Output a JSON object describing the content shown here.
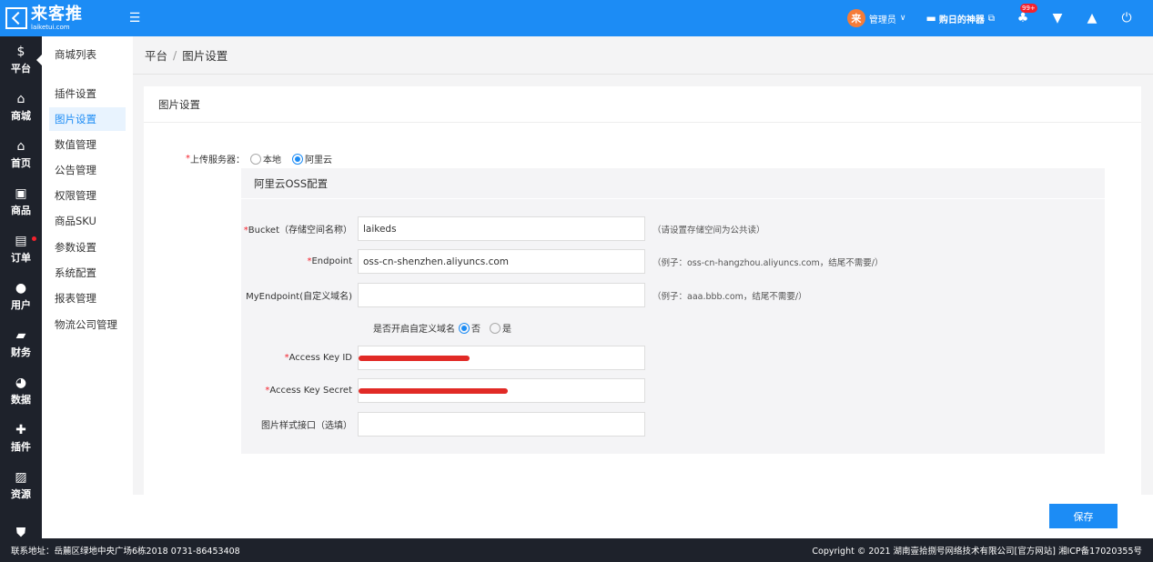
{
  "brand": {
    "name_cn": "来客推",
    "name_en": "laiketui.com",
    "logo_icon": "logo-mark"
  },
  "topbar": {
    "admin_avatar_text": "来",
    "admin_name": "管理员",
    "store_name": "购日的神器",
    "notification_badge": "99+",
    "icons": [
      "bell-icon",
      "shirt-icon",
      "store-icon",
      "power-icon"
    ]
  },
  "iconnav": [
    {
      "label": "平台",
      "icon": "dollar-icon",
      "glyph": "$",
      "active": true
    },
    {
      "label": "商城",
      "icon": "home-icon",
      "glyph": "⌂"
    },
    {
      "label": "首页",
      "icon": "home-icon",
      "glyph": "⌂"
    },
    {
      "label": "商品",
      "icon": "bag-icon",
      "glyph": "▣"
    },
    {
      "label": "订单",
      "icon": "clipboard-icon",
      "glyph": "▤",
      "dot": true
    },
    {
      "label": "用户",
      "icon": "user-icon",
      "glyph": "●"
    },
    {
      "label": "财务",
      "icon": "wallet-icon",
      "glyph": "▰"
    },
    {
      "label": "数据",
      "icon": "pie-icon",
      "glyph": "◕"
    },
    {
      "label": "插件",
      "icon": "puzzle-icon",
      "glyph": "✚"
    },
    {
      "label": "资源",
      "icon": "image-icon",
      "glyph": "▨"
    },
    {
      "label": "",
      "icon": "shield-icon",
      "glyph": "⛊"
    }
  ],
  "subnav": {
    "items": [
      "商城列表",
      "插件设置",
      "图片设置",
      "数值管理",
      "公告管理",
      "权限管理",
      "商品SKU",
      "参数设置",
      "系统配置",
      "报表管理",
      "物流公司管理"
    ],
    "active_index": 2
  },
  "breadcrumb": {
    "root": "平台",
    "separator": "/",
    "current": "图片设置"
  },
  "card": {
    "title": "图片设置",
    "upload_label": "上传服务器：",
    "upload_options": [
      "本地",
      "阿里云"
    ],
    "upload_selected": "阿里云",
    "oss_title": "阿里云OSS配置",
    "fields": {
      "bucket": {
        "label": "Bucket（存储空间名称）",
        "value": "laikeds",
        "hint": "（请设置存储空间为公共读）",
        "required": true
      },
      "endpoint": {
        "label": "Endpoint",
        "value": "oss-cn-shenzhen.aliyuncs.com",
        "hint": "（例子：oss-cn-hangzhou.aliyuncs.com，结尾不需要/）",
        "required": true
      },
      "myendpoint": {
        "label": "MyEndpoint(自定义域名)",
        "value": "",
        "hint": "（例子：aaa.bbb.com，结尾不需要/）",
        "required": false
      },
      "custom_domain": {
        "label": "是否开启自定义域名",
        "options": [
          "否",
          "是"
        ],
        "selected": "否"
      },
      "access_key_id": {
        "label": "Access Key ID",
        "value": "",
        "required": true
      },
      "access_key_secret": {
        "label": "Access Key Secret",
        "value": "",
        "required": true
      },
      "image_style": {
        "label": "图片样式接口（选填）",
        "value": "",
        "required": false
      }
    }
  },
  "save_label": "保存",
  "footer": {
    "address": "联系地址：岳麓区绿地中央广场6栋2018 0731-86453408",
    "copyright": "Copyright © 2021 湖南壹拾捌号网络技术有限公司[官方网站]  湘ICP备17020355号"
  },
  "colors": {
    "primary": "#1c8cf5",
    "sidebar": "#1e222b",
    "required": "#f5222d",
    "redaction": "#e12a26"
  }
}
